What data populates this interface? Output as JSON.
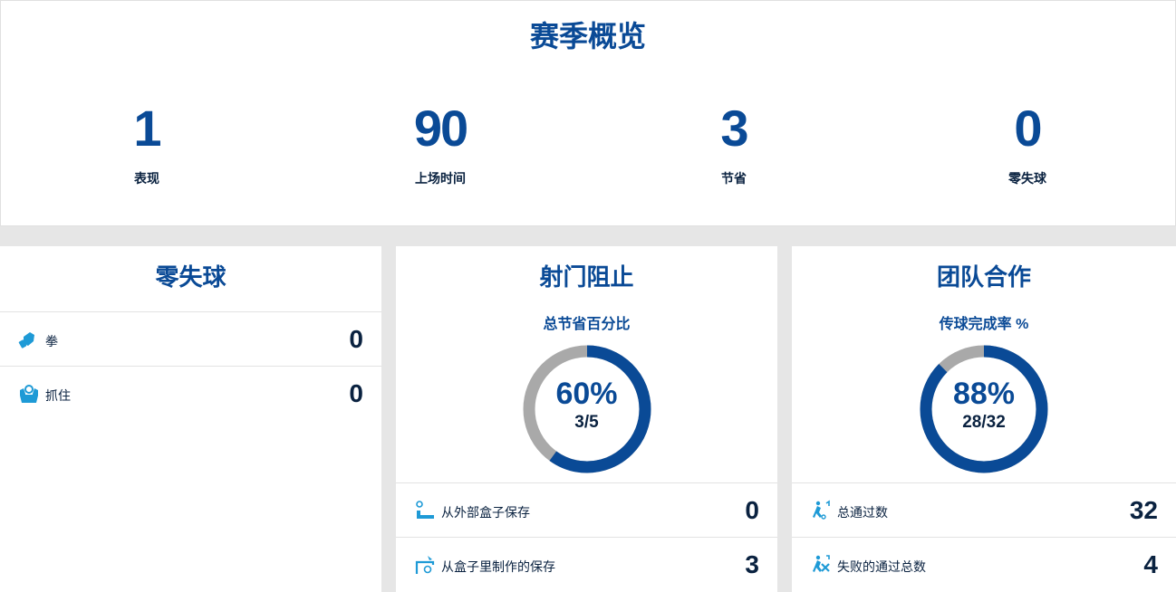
{
  "summary": {
    "title": "赛季概览",
    "stats": [
      {
        "value": "1",
        "label": "表现"
      },
      {
        "value": "90",
        "label": "上场时间"
      },
      {
        "value": "3",
        "label": "节省"
      },
      {
        "value": "0",
        "label": "零失球"
      }
    ]
  },
  "clean_sheets": {
    "title": "零失球",
    "rows": [
      {
        "icon": "punch-icon",
        "label": "拳",
        "value": "0"
      },
      {
        "icon": "catch-icon",
        "label": "抓住",
        "value": "0"
      }
    ]
  },
  "shot_stopping": {
    "title": "射门阻止",
    "subtitle": "总节省百分比",
    "percent_text": "60%",
    "fraction_text": "3/5",
    "ratio": 0.6,
    "rows": [
      {
        "icon": "save-outside-box-icon",
        "label": "从外部盒子保存",
        "value": "0"
      },
      {
        "icon": "save-inside-box-icon",
        "label": "从盒子里制作的保存",
        "value": "3"
      }
    ]
  },
  "teamwork": {
    "title": "团队合作",
    "subtitle": "传球完成率 %",
    "percent_text": "88%",
    "fraction_text": "28/32",
    "ratio": 0.875,
    "rows": [
      {
        "icon": "total-passes-icon",
        "label": "总通过数",
        "value": "32"
      },
      {
        "icon": "failed-passes-icon",
        "label": "失败的通过总数",
        "value": "4"
      }
    ]
  },
  "colors": {
    "primary": "#0a4a96",
    "text": "#0a2240",
    "ring_bg": "#a9a9a9",
    "icon": "#1e9ad6",
    "page_bg": "#e6e6e6"
  }
}
